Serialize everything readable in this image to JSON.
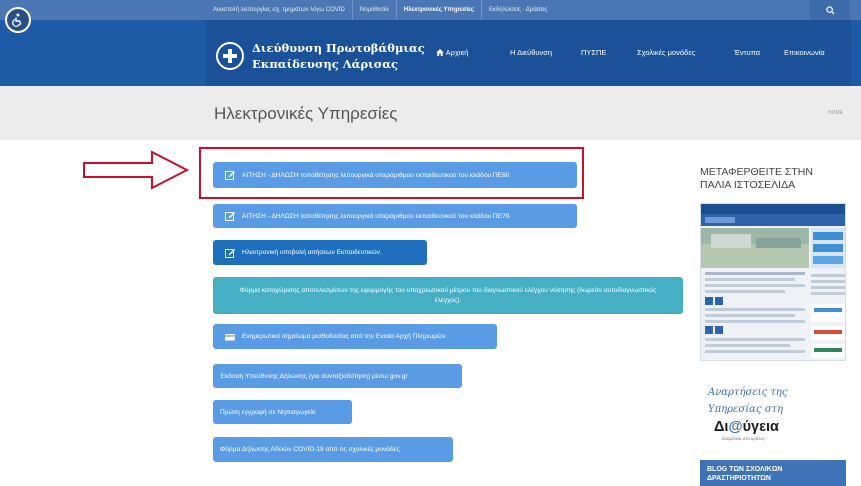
{
  "topbar": {
    "links": [
      {
        "label": "Αναστολή λειτουργίας σχ. τμημάτων λόγω COVID",
        "active": false
      },
      {
        "label": "Νομοθεσία",
        "active": false
      },
      {
        "label": "Ηλεκτρονικές Υπηρεσίες",
        "active": true
      },
      {
        "label": "Εκδηλώσεις - Δράσεις",
        "active": false
      }
    ]
  },
  "header": {
    "logo_line1": "Διεύθυνση Πρωτοβάθμιας",
    "logo_line2": "Εκπαίδευσης Λάρισας",
    "nav": [
      {
        "label": "Αρχική"
      },
      {
        "label": "Η Διεύθυνση"
      },
      {
        "label": "ΠΥΣΠΕ"
      },
      {
        "label": "Σχολικές μονάδες"
      },
      {
        "label": "Έντυπα"
      },
      {
        "label": "Επικοινωνία"
      }
    ]
  },
  "page": {
    "title": "Ηλεκτρονικές Υπηρεσίες",
    "breadcrumb": "HOME"
  },
  "services": [
    {
      "label": "ΑΙΤΗΣΗ - ΔΗΛΩΣΗ τοποθέτησης λειτουργικά υπεράριθμου εκπαιδευτικού του κλάδου ΠΕ60",
      "icon": "edit-icon"
    },
    {
      "label": "ΑΙΤΗΣΗ - ΔΗΛΩΣΗ τοποθέτησης λειτουργικά υπεράριθμου εκπαιδευτικού του κλάδου ΠΕ70",
      "icon": "edit-icon"
    },
    {
      "label": "Ηλεκτρονική υποβολή αιτήσεων Εκπαιδευτικών.",
      "icon": "edit-icon"
    },
    {
      "label": "Φόρμα καταχώρισης αποτελεσμάτων της εφαρμογής του υποχρεωτικού μέτρου του διαγνωστικού ελέγχου νόσησης (δωρεάν αυτοδιαγνωστικός έλεγχος).",
      "icon": ""
    },
    {
      "label": "Ενημερωτικό σημείωμα μισθοδοσίας από την Ενιαία Αρχή Πληρωμών",
      "icon": "card-icon"
    },
    {
      "label": "Έκδοση Υπεύθυνης Δήλωσης (για συνταξιοδότηση) μέσω gov.gr",
      "icon": ""
    },
    {
      "label": "Πρώτη εγγραφή σε Νηπιαγωγείο",
      "icon": ""
    },
    {
      "label": "Φόρμα Δήλωσης Αδειών COVID-19 από τις σχολικές μονάδες",
      "icon": ""
    }
  ],
  "sidebar": {
    "old_site_line1": "ΜΕΤΑΦΕΡΘΕΙΤΕ ΣΤΗΝ",
    "old_site_line2": "ΠΑΛΙΑ ΙΣΤΟΣΕΛΙΔΑ",
    "diavgeia_line1": "Αναρτήσεις της",
    "diavgeia_line2": "Υπηρεσίας στη",
    "diavgeia_logo_pre": "Δι",
    "diavgeia_logo_at": "@",
    "diavgeia_logo_post": "ύγεια",
    "diavgeia_sub": "διαφάνεια στο κράτος",
    "blog_line1": "BLOG ΤΩΝ ΣΧΟΛΙΚΩΝ",
    "blog_line2": "ΔΡΑΣΤΗΡΙΟΤΗΤΩΝ"
  },
  "colors": {
    "header_blue": "#1f5aa6",
    "button_blue": "#5a9be5",
    "button_dark": "#1f6fbf",
    "button_teal": "#46afc4",
    "annotation_red": "#c8102e"
  }
}
